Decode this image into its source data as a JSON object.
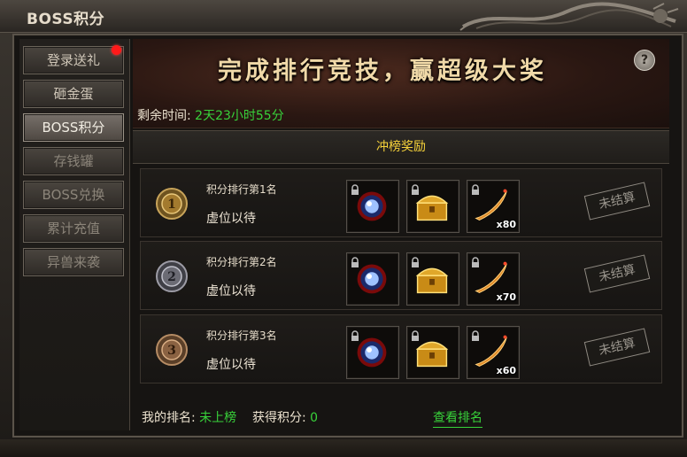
{
  "window": {
    "title": "BOSS积分"
  },
  "sidebar": {
    "items": [
      {
        "label": "登录送礼",
        "notify": true
      },
      {
        "label": "砸金蛋"
      },
      {
        "label": "BOSS积分",
        "active": true
      },
      {
        "label": "存钱罐"
      },
      {
        "label": "BOSS兑换"
      },
      {
        "label": "累计充值"
      },
      {
        "label": "异兽来袭"
      }
    ]
  },
  "banner": {
    "slogan": "完成排行竞技，赢超级大奖",
    "help_label": "?"
  },
  "timer": {
    "label": "剩余时间:",
    "value": "2天23小时55分"
  },
  "section": {
    "title": "冲榜奖励"
  },
  "ranks": [
    {
      "medal": "1",
      "title": "积分排行第1名",
      "holder": "虚位以待",
      "qty": "x80",
      "status": "未结算"
    },
    {
      "medal": "2",
      "title": "积分排行第2名",
      "holder": "虚位以待",
      "qty": "x70",
      "status": "未结算"
    },
    {
      "medal": "3",
      "title": "积分排行第3名",
      "holder": "虚位以待",
      "qty": "x60",
      "status": "未结算"
    }
  ],
  "footer": {
    "my_rank_label": "我的排名:",
    "my_rank_value": "未上榜",
    "score_label": "获得积分:",
    "score_value": "0",
    "view_link": "查看排名"
  },
  "colors": {
    "accent_green": "#38d23a",
    "gold": "#f6d23a",
    "notify_red": "#ff1a1a"
  },
  "icons": [
    "lock-icon",
    "orb-icon",
    "treasure-chest-icon",
    "flame-feather-icon",
    "help-icon",
    "medal-icon",
    "dragon-ornament"
  ]
}
